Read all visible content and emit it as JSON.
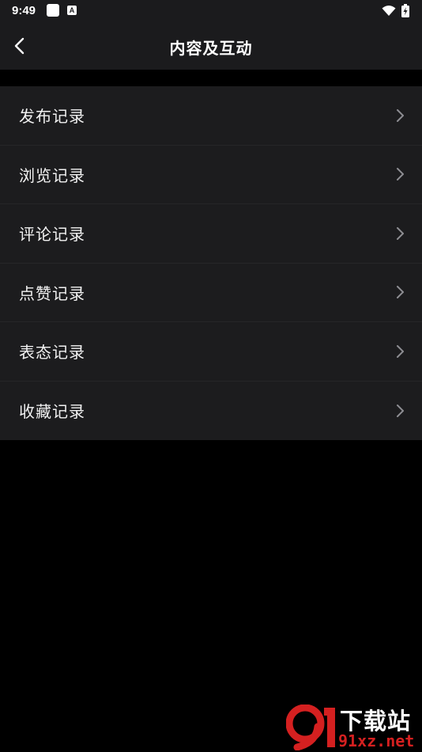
{
  "status_bar": {
    "time": "9:49",
    "notif_letter": "A"
  },
  "header": {
    "title": "内容及互动"
  },
  "menu": {
    "items": [
      {
        "label": "发布记录"
      },
      {
        "label": "浏览记录"
      },
      {
        "label": "评论记录"
      },
      {
        "label": "点赞记录"
      },
      {
        "label": "表态记录"
      },
      {
        "label": "收藏记录"
      }
    ]
  },
  "watermark": {
    "title": "下载站",
    "url": "91xz.net"
  },
  "colors": {
    "background": "#000000",
    "bar": "#1b1b1d",
    "list": "#1c1c1e",
    "chevron": "#8e8e93",
    "watermark_red": "#d42020"
  },
  "icons": {
    "back": "chevron-left-icon",
    "row": "chevron-right-icon",
    "wifi": "wifi-icon",
    "battery": "battery-charging-icon"
  }
}
